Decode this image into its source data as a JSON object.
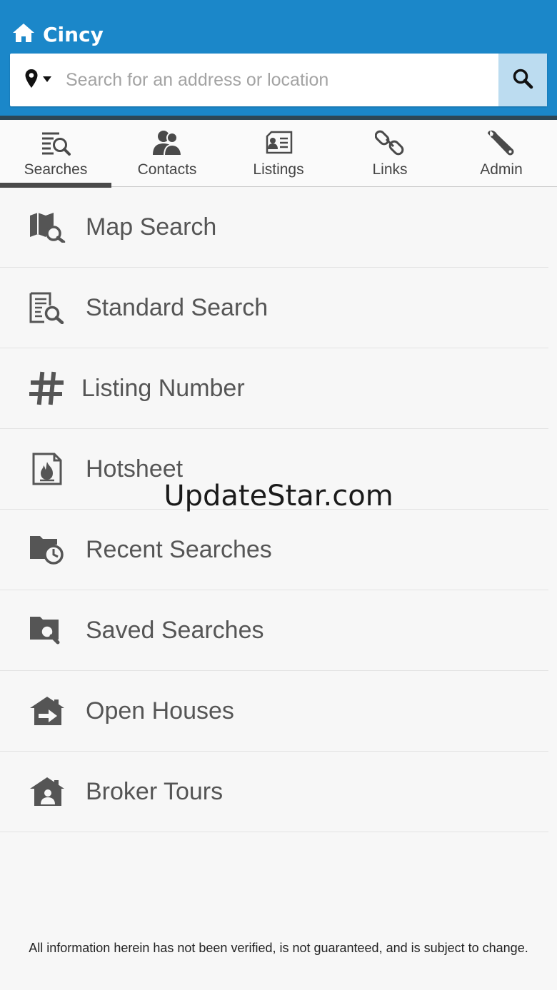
{
  "header": {
    "title": "Cincy",
    "home_icon": "home-icon",
    "bg_color": "#1b87c9"
  },
  "search": {
    "placeholder": "Search for an address or location",
    "value": "",
    "location_icon": "map-pin-icon",
    "button_icon": "search-icon"
  },
  "tabs": [
    {
      "label": "Searches",
      "icon": "search-list-icon",
      "active": true
    },
    {
      "label": "Contacts",
      "icon": "contacts-icon",
      "active": false
    },
    {
      "label": "Listings",
      "icon": "listings-icon",
      "active": false
    },
    {
      "label": "Links",
      "icon": "link-icon",
      "active": false
    },
    {
      "label": "Admin",
      "icon": "wrench-icon",
      "active": false
    }
  ],
  "menu": {
    "items": [
      {
        "label": "Map Search",
        "icon": "map-search-icon"
      },
      {
        "label": "Standard Search",
        "icon": "standard-search-icon"
      },
      {
        "label": "Listing Number",
        "icon": "hash-icon"
      },
      {
        "label": "Hotsheet",
        "icon": "hotsheet-icon"
      },
      {
        "label": "Recent Searches",
        "icon": "recent-searches-icon"
      },
      {
        "label": "Saved Searches",
        "icon": "saved-searches-icon"
      },
      {
        "label": "Open Houses",
        "icon": "open-houses-icon"
      },
      {
        "label": "Broker Tours",
        "icon": "broker-tours-icon"
      }
    ]
  },
  "watermark": "UpdateStar.com",
  "footer": {
    "disclaimer": "All information herein has not been verified, is not guaranteed, and is subject to change."
  }
}
